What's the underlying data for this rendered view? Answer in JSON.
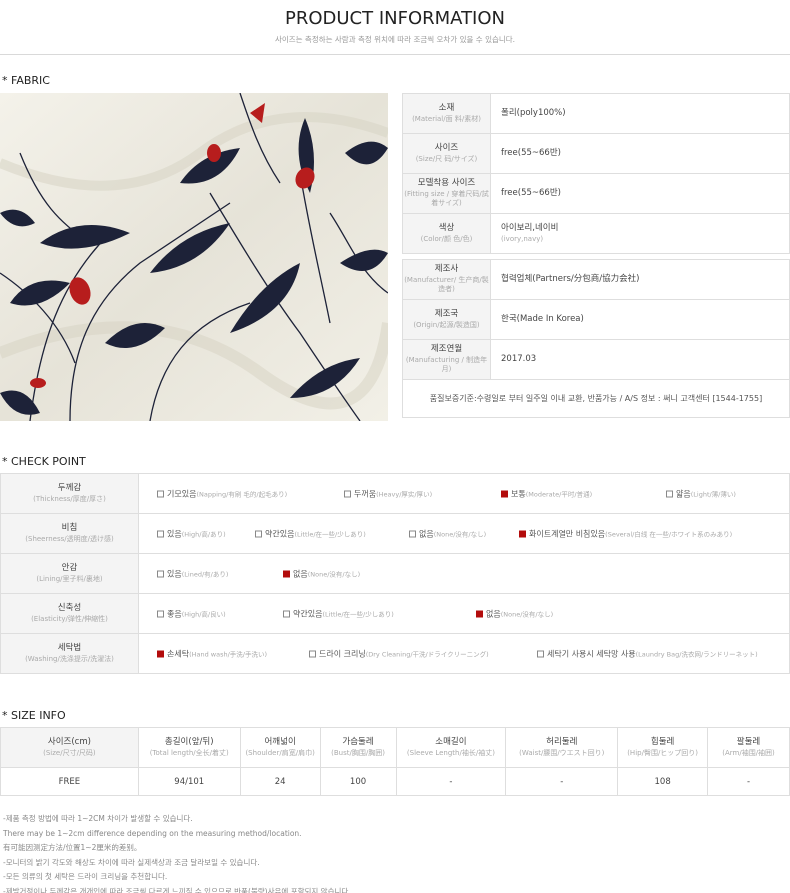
{
  "header": {
    "title": "PRODUCT INFORMATION",
    "subtitle": "사이즈는 측정하는 사람과 측정 위치에 따라 조금씩 오차가 있을 수 있습니다."
  },
  "fabric": {
    "section_title": "* FABRIC",
    "photo_icon": "floral-fabric-photo",
    "rows": [
      {
        "label": "소재",
        "label_en": "(Material/面 料/素材)",
        "value": "폴리(poly100%)",
        "value_en": ""
      },
      {
        "label": "사이즈",
        "label_en": "(Size/尺 码/サイズ)",
        "value": "free(55~66반)",
        "value_en": ""
      },
      {
        "label": "모델착용 사이즈",
        "label_en": "(Fitting size / 穿着尺码/試着サイズ)",
        "value": "free(55~66반)",
        "value_en": ""
      },
      {
        "label": "색상",
        "label_en": "(Color/颜 色/色)",
        "value": "아이보리,네이비",
        "value_en": "(ivory,navy)"
      }
    ],
    "rows2": [
      {
        "label": "제조사",
        "label_en": "(Manufacturer/ 生产商/製造者)",
        "value": "협력업체(Partners/分包商/協力会社)"
      },
      {
        "label": "제조국",
        "label_en": "(Origin/起源/製造国)",
        "value": "한국(Made In Korea)"
      },
      {
        "label": "제조연월",
        "label_en": "(Manufacturing / 制造年月)",
        "value": "2017.03"
      }
    ],
    "note": "품질보증기준:수령일로 부터 일주일 이내 교환, 반품가능 /   A/S 정보 : 써니 고객센터 [1544-1755]"
  },
  "check": {
    "section_title": "* CHECK POINT",
    "rows": [
      {
        "label": "두께감",
        "label_en": "(Thickness/厚度/厚さ)",
        "options": [
          {
            "text": "기모있음",
            "sub": "(Napping/有刷 毛的/起毛あり)",
            "checked": false
          },
          {
            "text": "두꺼움",
            "sub": "(Heavy/厚实/厚い)",
            "checked": false
          },
          {
            "text": "보통",
            "sub": "(Moderate/平时/普通)",
            "checked": true
          },
          {
            "text": "얇음",
            "sub": "(Light/薄/薄い)",
            "checked": false
          }
        ]
      },
      {
        "label": "비침",
        "label_en": "(Sheerness/透明度/透け感)",
        "options": [
          {
            "text": "있음",
            "sub": "(High/高/あり)",
            "checked": false
          },
          {
            "text": "약간있음",
            "sub": "(Little/在一些/少しあり)",
            "checked": false
          },
          {
            "text": "없음",
            "sub": "(None/没有/なし)",
            "checked": false
          },
          {
            "text": "화이트계열만 비침있음",
            "sub": "(Several/白线 在一些/ホワイト系のみあり)",
            "checked": true
          }
        ]
      },
      {
        "label": "안감",
        "label_en": "(Lining/里子料/裏地)",
        "options": [
          {
            "text": "있음",
            "sub": "(Lined/有/あり)",
            "checked": false
          },
          {
            "text": "없음",
            "sub": "(None/没有/なし)",
            "checked": true
          }
        ]
      },
      {
        "label": "신축성",
        "label_en": "(Elasticity/弹性/伸縮性)",
        "options": [
          {
            "text": "좋음",
            "sub": "(High/高/良い)",
            "checked": false
          },
          {
            "text": "약간있음",
            "sub": "(Little/在一些/少しあり)",
            "checked": false
          },
          {
            "text": "없음",
            "sub": "(None/没有/なし)",
            "checked": true
          }
        ]
      },
      {
        "label": "세탁법",
        "label_en": "(Washing/洗涤提示/洗濯法)",
        "options": [
          {
            "text": "손세탁",
            "sub": "(Hand wash/手洗/手洗い)",
            "checked": true
          },
          {
            "text": "드라이 크리닝",
            "sub": "(Dry Cleaning/干洗/ドライクリーニング)",
            "checked": false
          },
          {
            "text": "세탁기 사용시 세탁망 사용",
            "sub": "(Laundry Bag/洗衣网/ランドリーネット)",
            "checked": false
          }
        ]
      }
    ]
  },
  "size": {
    "section_title": "* SIZE INFO",
    "headers": [
      {
        "label": "사이즈(cm)",
        "en": "(Size/尺寸/尺码)"
      },
      {
        "label": "총길이(앞/뒤)",
        "en": "(Total length/全长/着丈)"
      },
      {
        "label": "어깨넓이",
        "en": "(Shoulder/肩宽/肩巾)"
      },
      {
        "label": "가슴둘레",
        "en": "(Bust/胸围/胸囲)"
      },
      {
        "label": "소매길이",
        "en": "(Sleeve Length/袖长/袖丈)"
      },
      {
        "label": "허리둘레",
        "en": "(Waist/腰围/ウエスト回り)"
      },
      {
        "label": "힙둘레",
        "en": "(Hip/臀围/ヒップ回り)"
      },
      {
        "label": "팔둘레",
        "en": "(Arm/袖围/袖囲)"
      }
    ],
    "row": [
      "FREE",
      "94/101",
      "24",
      "100",
      "-",
      "-",
      "108",
      "-"
    ]
  },
  "notes": [
    "-제품 측정 방법에 따라 1~2CM 차이가 발생할 수 있습니다.",
    "There may be 1~2cm difference depending on the measuring method/location.",
    "有可能因测定方法/位置1~2厘米的差别。",
    "-모니터의 밝기 각도와 해상도 차이에 따라 실제색상과 조금 달라보일 수 있습니다.",
    "-모든 의류의 첫 세탁은 드라이 크리닝을 추천합니다.",
    "-제발거점이나 두께감은 개개인에 따라 조금씩 다르게 느끼질 수 있으므로,반품(불량)사유에 포함되지 않습니다."
  ]
}
